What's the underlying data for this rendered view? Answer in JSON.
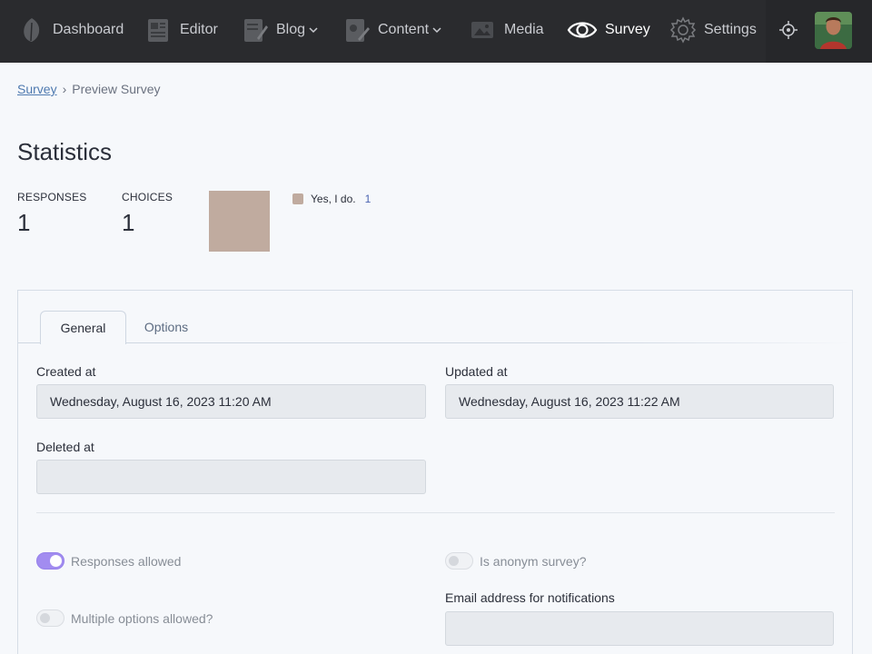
{
  "nav": {
    "items": [
      {
        "label": "Dashboard",
        "icon": "leaf-icon"
      },
      {
        "label": "Editor",
        "icon": "newspaper-icon"
      },
      {
        "label": "Blog",
        "icon": "document-edit-icon"
      },
      {
        "label": "Content",
        "icon": "content-edit-icon"
      },
      {
        "label": "Media",
        "icon": "image-icon"
      },
      {
        "label": "Survey",
        "icon": "eye-icon"
      },
      {
        "label": "Settings",
        "icon": "gear-icon"
      }
    ]
  },
  "breadcrumb": {
    "root": "Survey",
    "current": "Preview Survey"
  },
  "page": {
    "title": "Statistics"
  },
  "stats": {
    "responses_label": "RESPONSES",
    "responses_value": "1",
    "choices_label": "CHOICES",
    "choices_value": "1"
  },
  "chart_data": {
    "type": "pie",
    "categories": [
      "Yes, I do."
    ],
    "values": [
      1
    ],
    "colors": [
      "#c0ab9f"
    ]
  },
  "legend": {
    "label": "Yes, I do.",
    "count": "1"
  },
  "tabs": [
    {
      "label": "General",
      "active": true
    },
    {
      "label": "Options",
      "active": false
    }
  ],
  "form": {
    "created_label": "Created at",
    "created_value": "Wednesday, August 16, 2023 11:20 AM",
    "updated_label": "Updated at",
    "updated_value": "Wednesday, August 16, 2023 11:22 AM",
    "deleted_label": "Deleted at",
    "deleted_value": "",
    "responses_allowed_label": "Responses allowed",
    "responses_allowed": true,
    "anonym_label": "Is anonym survey?",
    "anonym": false,
    "multiple_label": "Multiple options allowed?",
    "multiple": false,
    "email_label": "Email address for notifications",
    "email_value": ""
  },
  "colors": {
    "accent": "#a28cf0",
    "nav_bg": "#2a2b2e",
    "chart_slice": "#c0ab9f"
  }
}
